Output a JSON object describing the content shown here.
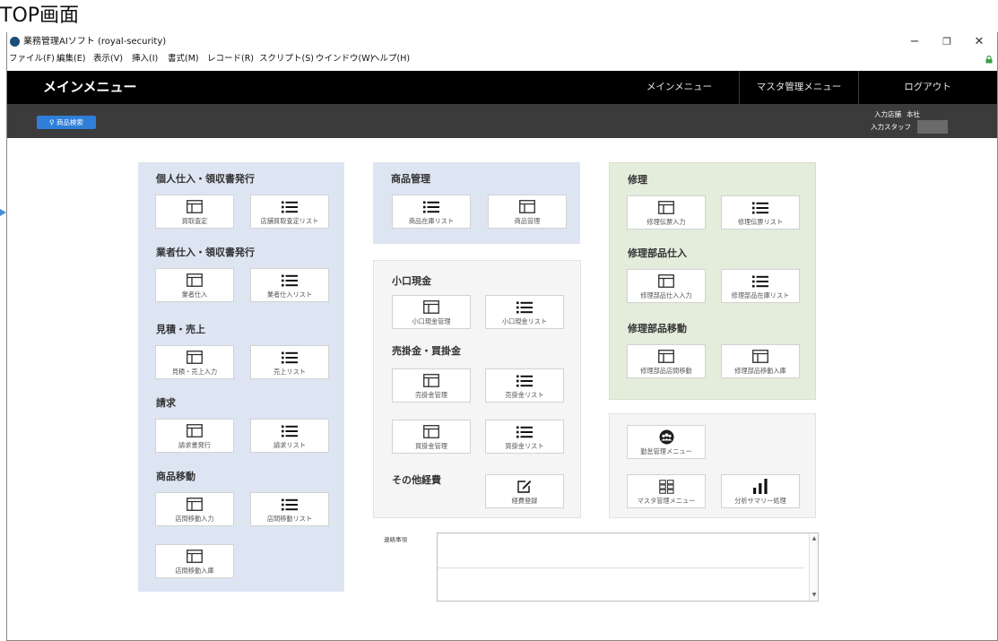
{
  "page_caption": "TOP画面",
  "window": {
    "title": "業務管理AIソフト (royal-security)",
    "minimize": "−",
    "maximize": "❐",
    "close": "✕"
  },
  "menubar": [
    "ファイル(F)",
    "編集(E)",
    "表示(V)",
    "挿入(I)",
    "書式(M)",
    "レコード(R)",
    "スクリプト(S)",
    "ウインドウ(W)",
    "ヘルプ(H)"
  ],
  "header": {
    "title": "メインメニュー",
    "nav": [
      "メインメニュー",
      "マスタ管理メニュー",
      "ログアウト"
    ]
  },
  "toolbar": {
    "search_button": "商品検索",
    "store_label": "入力店舗",
    "store_value": "本社",
    "staff_label": "入力スタッフ",
    "staff_value": ""
  },
  "left_panel": {
    "sections": [
      {
        "title": "個人仕入・領収書発行",
        "tiles": [
          {
            "label": "買取査定",
            "icon": "window-icon"
          },
          {
            "label": "店舗買取査定リスト",
            "icon": "list-icon"
          }
        ]
      },
      {
        "title": "業者仕入・領収書発行",
        "tiles": [
          {
            "label": "業者仕入",
            "icon": "window-icon"
          },
          {
            "label": "業者仕入リスト",
            "icon": "list-icon"
          }
        ]
      },
      {
        "title": "見積・売上",
        "tiles": [
          {
            "label": "見積・売上入力",
            "icon": "window-icon"
          },
          {
            "label": "売上リスト",
            "icon": "list-icon"
          }
        ]
      },
      {
        "title": "請求",
        "tiles": [
          {
            "label": "請求書発行",
            "icon": "window-icon"
          },
          {
            "label": "請求リスト",
            "icon": "list-icon"
          }
        ]
      },
      {
        "title": "商品移動",
        "tiles": [
          {
            "label": "店間移動入力",
            "icon": "window-icon"
          },
          {
            "label": "店間移動リスト",
            "icon": "list-icon"
          },
          {
            "label": "店間移動入庫",
            "icon": "window-icon"
          }
        ]
      }
    ]
  },
  "middle_top_panel": {
    "title": "商品管理",
    "tiles": [
      {
        "label": "商品在庫リスト",
        "icon": "list-icon"
      },
      {
        "label": "商品管理",
        "icon": "window-icon"
      }
    ]
  },
  "middle_panel": {
    "sections": [
      {
        "title": "小口現金",
        "tiles": [
          {
            "label": "小口現金管理",
            "icon": "window-icon"
          },
          {
            "label": "小口現金リスト",
            "icon": "list-icon"
          }
        ]
      },
      {
        "title": "売掛金・買掛金",
        "tiles": [
          {
            "label": "売掛金管理",
            "icon": "window-icon"
          },
          {
            "label": "売掛金リスト",
            "icon": "list-icon"
          },
          {
            "label": "買掛金管理",
            "icon": "window-icon"
          },
          {
            "label": "買掛金リスト",
            "icon": "list-icon"
          }
        ]
      },
      {
        "title": "その他経費",
        "tiles": [
          {
            "label": "経費登録",
            "icon": "edit-icon"
          }
        ]
      }
    ]
  },
  "right_panel": {
    "sections": [
      {
        "title": "修理",
        "tiles": [
          {
            "label": "修理伝票入力",
            "icon": "window-icon"
          },
          {
            "label": "修理伝票リスト",
            "icon": "list-icon"
          }
        ]
      },
      {
        "title": "修理部品仕入",
        "tiles": [
          {
            "label": "修理部品仕入入力",
            "icon": "window-icon"
          },
          {
            "label": "修理部品在庫リスト",
            "icon": "list-icon"
          }
        ]
      },
      {
        "title": "修理部品移動",
        "tiles": [
          {
            "label": "修理部品店間移動",
            "icon": "window-icon"
          },
          {
            "label": "修理部品移動入庫",
            "icon": "window-icon"
          }
        ]
      }
    ]
  },
  "right_bottom_panel": {
    "tiles": [
      {
        "label": "勤怠管理メニュー",
        "icon": "people-icon"
      },
      {
        "label": "マスタ管理メニュー",
        "icon": "grid-icon"
      },
      {
        "label": "分析サマリー処理",
        "icon": "bar-chart-icon"
      }
    ]
  },
  "memo": {
    "label": "連絡事項",
    "value": "",
    "scroll_up": "▲",
    "scroll_down": "▼"
  },
  "colors": {
    "header_bg": "#000000",
    "toolbar_bg": "#3b3b3b",
    "search_button": "#2f7fd8",
    "panel_blue": "#dde5f3",
    "panel_green": "#e4ecdc",
    "panel_gray": "#f5f5f5"
  }
}
